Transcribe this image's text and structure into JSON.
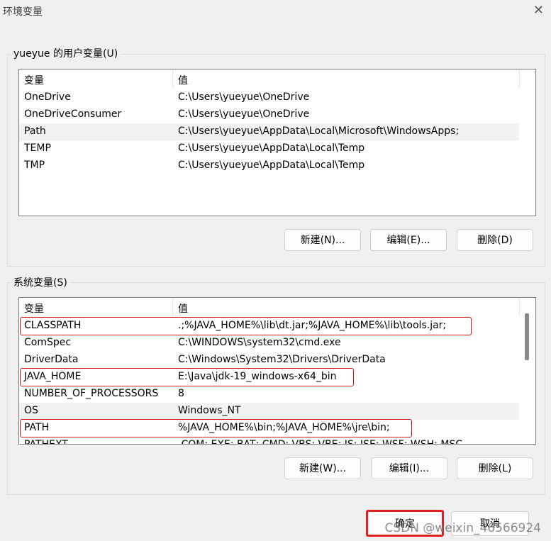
{
  "window": {
    "title": "环境变量",
    "close_label": "✕"
  },
  "user_vars": {
    "label": "yueyue 的用户变量(U)",
    "col_name": "变量",
    "col_value": "值",
    "rows": [
      {
        "name": "OneDrive",
        "value": "C:\\Users\\yueyue\\OneDrive"
      },
      {
        "name": "OneDriveConsumer",
        "value": "C:\\Users\\yueyue\\OneDrive"
      },
      {
        "name": "Path",
        "value": "C:\\Users\\yueyue\\AppData\\Local\\Microsoft\\WindowsApps;"
      },
      {
        "name": "TEMP",
        "value": "C:\\Users\\yueyue\\AppData\\Local\\Temp"
      },
      {
        "name": "TMP",
        "value": "C:\\Users\\yueyue\\AppData\\Local\\Temp"
      }
    ],
    "buttons": {
      "new": "新建(N)...",
      "edit": "编辑(E)...",
      "delete": "删除(D)"
    }
  },
  "system_vars": {
    "label": "系统变量(S)",
    "col_name": "变量",
    "col_value": "值",
    "rows": [
      {
        "name": "CLASSPATH",
        "value": ".;%JAVA_HOME%\\lib\\dt.jar;%JAVA_HOME%\\lib\\tools.jar;"
      },
      {
        "name": "ComSpec",
        "value": "C:\\WINDOWS\\system32\\cmd.exe"
      },
      {
        "name": "DriverData",
        "value": "C:\\Windows\\System32\\Drivers\\DriverData"
      },
      {
        "name": "JAVA_HOME",
        "value": "E:\\Java\\jdk-19_windows-x64_bin"
      },
      {
        "name": "NUMBER_OF_PROCESSORS",
        "value": "8"
      },
      {
        "name": "OS",
        "value": "Windows_NT"
      },
      {
        "name": "PATH",
        "value": "%JAVA_HOME%\\bin;%JAVA_HOME%\\jre\\bin;"
      },
      {
        "name": "PATHEXT",
        "value": ".COM;.EXE;.BAT;.CMD;.VBS;.VBE;.JS;.JSE;.WSF;.WSH;.MSC"
      }
    ],
    "buttons": {
      "new": "新建(W)...",
      "edit": "编辑(I)...",
      "delete": "删除(L)"
    }
  },
  "footer": {
    "ok": "确定",
    "cancel": "取消"
  },
  "watermark": "CSDN @weixin_46566924"
}
